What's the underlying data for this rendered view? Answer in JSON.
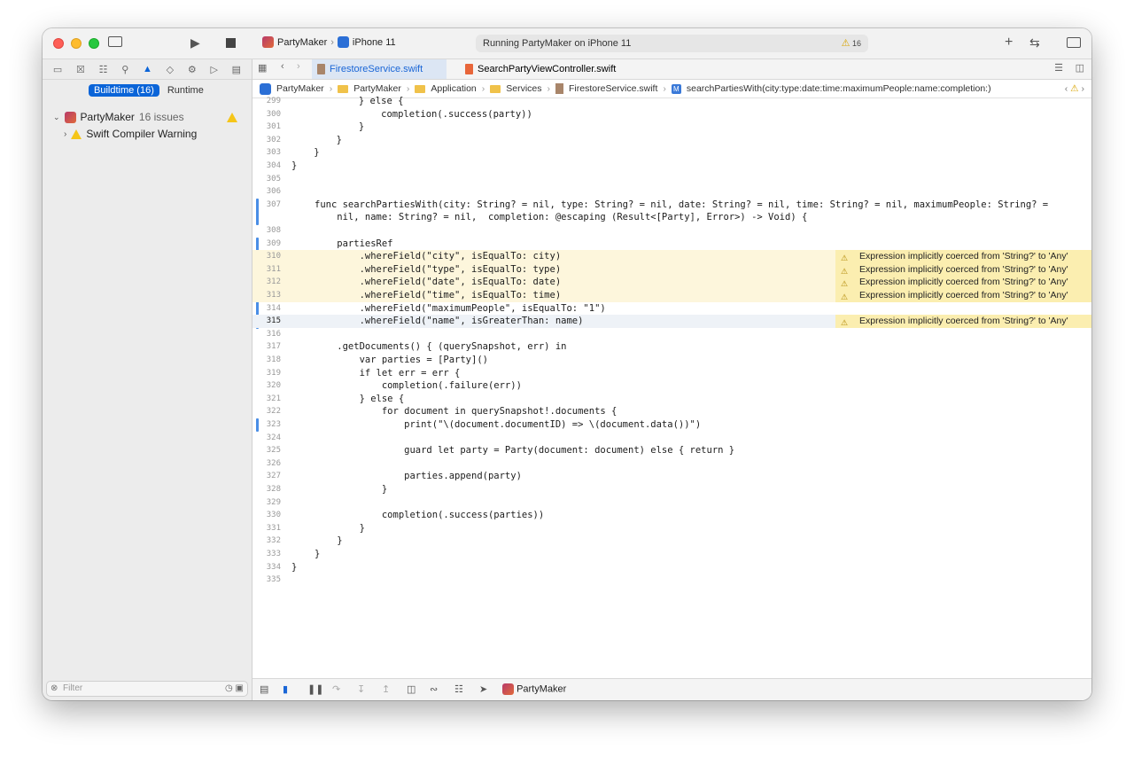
{
  "window": {
    "scheme_app": "PartyMaker",
    "scheme_device": "iPhone 11",
    "status_text": "Running PartyMaker on iPhone 11",
    "warning_count": "16"
  },
  "navigator": {
    "seg_buildtime": "Buildtime (16)",
    "seg_runtime": "Runtime",
    "project_name": "PartyMaker",
    "project_issues": "16 issues",
    "group_label": "Swift Compiler Warning",
    "filter_placeholder": "Filter"
  },
  "tabs": {
    "active": "FirestoreService.swift",
    "inactive": "SearchPartyViewController.swift"
  },
  "breadcrumb": {
    "c1": "PartyMaker",
    "c2": "PartyMaker",
    "c3": "Application",
    "c4": "Services",
    "c5": "FirestoreService.swift",
    "c6": "searchPartiesWith(city:type:date:time:maximumPeople:name:completion:)"
  },
  "code": {
    "n299": "299",
    "t299": "            } else {",
    "n300": "300",
    "t300": "                completion(.success(party))",
    "n301": "301",
    "t301": "            }",
    "n302": "302",
    "t302": "        }",
    "n303": "303",
    "t303": "    }",
    "n304": "304",
    "t304": "}",
    "n305": "305",
    "t305": "",
    "n306": "306",
    "t306": "",
    "n307": "307",
    "t307": "func searchPartiesWith(city: String? = nil, type: String? = nil, date: String? = nil, time: String? = nil, maximumPeople: String? =",
    "t307b": "    nil, name: String? = nil,  completion: @escaping (Result<[Party], Error>) -> Void) {",
    "n308": "308",
    "t308": "",
    "n309": "309",
    "t309": "    partiesRef",
    "n310": "310",
    "t310": "        .whereField(\"city\", isEqualTo: city)",
    "n311": "311",
    "t311": "        .whereField(\"type\", isEqualTo: type)",
    "n312": "312",
    "t312": "        .whereField(\"date\", isEqualTo: date)",
    "n313": "313",
    "t313": "        .whereField(\"time\", isEqualTo: time)",
    "n314": "314",
    "t314": "        .whereField(\"maximumPeople\", isEqualTo: \"1\")",
    "n315": "315",
    "t315": "        .whereField(\"name\", isGreaterThan: name)",
    "n316": "316",
    "t316": "",
    "n317": "317",
    "t317": "    .getDocuments() { (querySnapshot, err) in",
    "n318": "318",
    "t318": "        var parties = [Party]()",
    "n319": "319",
    "t319": "        if let err = err {",
    "n320": "320",
    "t320": "            completion(.failure(err))",
    "n321": "321",
    "t321": "        } else {",
    "n322": "322",
    "t322": "            for document in querySnapshot!.documents {",
    "n323": "323",
    "t323": "                print(\"\\(document.documentID) => \\(document.data())\")",
    "n324": "324",
    "t324": "",
    "n325": "325",
    "t325": "                guard let party = Party(document: document) else { return }",
    "n326": "326",
    "t326": "",
    "n327": "327",
    "t327": "                parties.append(party)",
    "n328": "328",
    "t328": "            }",
    "n329": "329",
    "t329": "",
    "n330": "330",
    "t330": "            completion(.success(parties))",
    "n331": "331",
    "t331": "        }",
    "n332": "332",
    "t332": "    }",
    "n333": "333",
    "t333": "}",
    "n334": "334",
    "t334": "}",
    "n335": "335",
    "t335": ""
  },
  "issues": {
    "msg": "Expression implicitly coerced from 'String?' to 'Any'"
  },
  "bottom": {
    "target": "PartyMaker"
  }
}
